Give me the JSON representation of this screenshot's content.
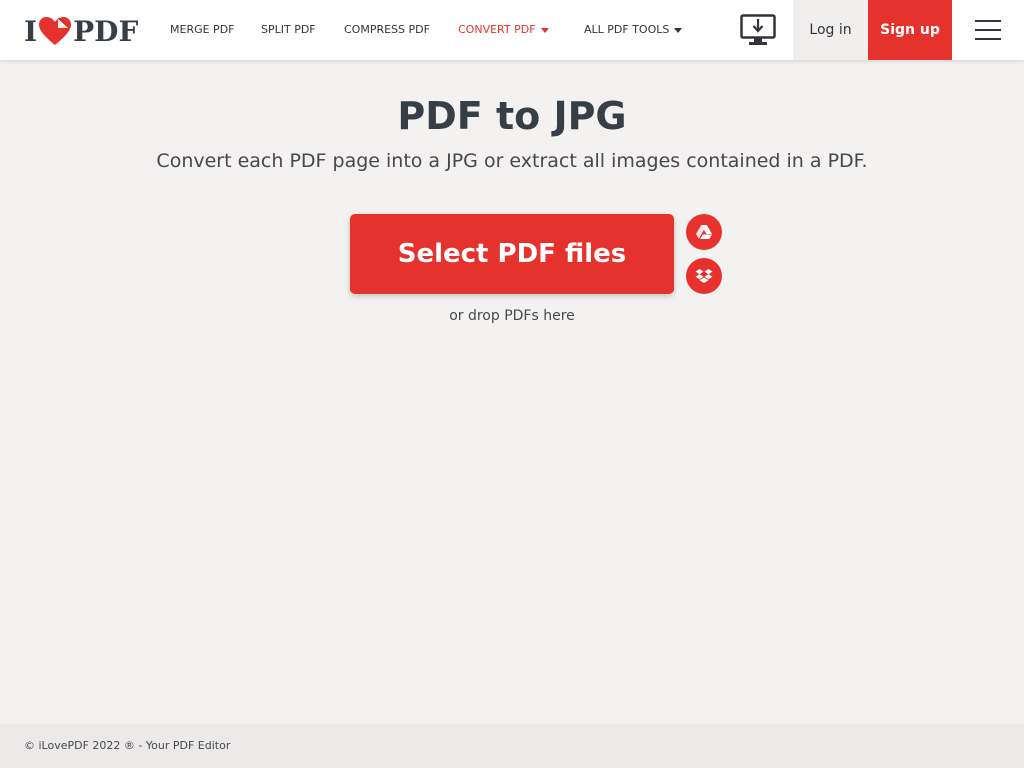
{
  "header": {
    "logo": {
      "left": "I",
      "right": "PDF"
    },
    "nav": [
      {
        "label": "MERGE PDF"
      },
      {
        "label": "SPLIT PDF"
      },
      {
        "label": "COMPRESS PDF"
      },
      {
        "label": "CONVERT PDF",
        "active": true,
        "dropdown": true
      },
      {
        "label": "ALL PDF TOOLS",
        "dropdown": true
      }
    ],
    "desktop_icon": "desktop-download-icon",
    "login_label": "Log in",
    "signup_label": "Sign up",
    "menu_icon": "hamburger-menu-icon"
  },
  "main": {
    "title": "PDF to JPG",
    "subtitle": "Convert each PDF page into a JPG or extract all images contained in a PDF.",
    "select_label": "Select PDF files",
    "cloud_buttons": [
      "google-drive-icon",
      "dropbox-icon"
    ],
    "drop_text": "or drop PDFs here"
  },
  "footer": {
    "text": "© iLovePDF 2022 ® - Your PDF Editor"
  },
  "colors": {
    "accent": "#e5322d",
    "background": "#f3f2f0",
    "text": "#33333b"
  }
}
